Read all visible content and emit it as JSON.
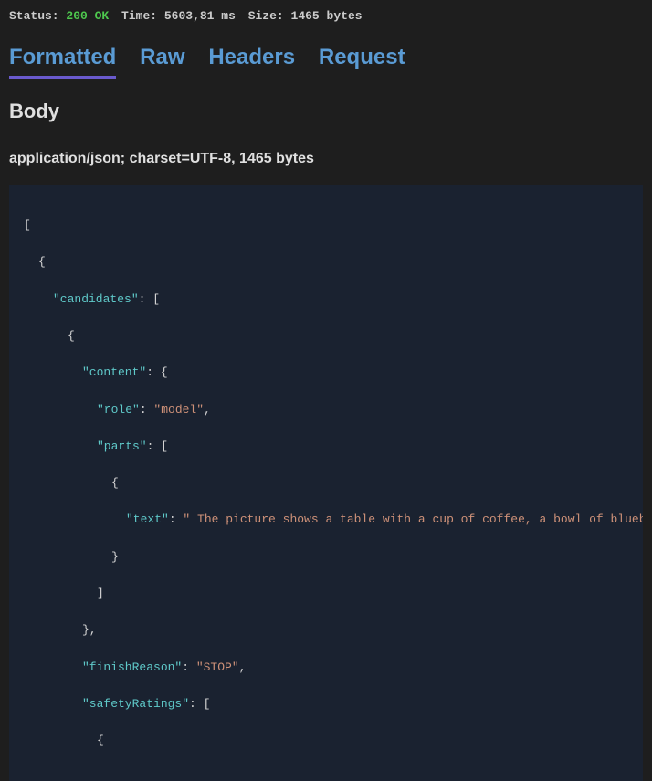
{
  "status_bar": {
    "status_label": "Status:",
    "status_value": "200 OK",
    "time_label": "Time:",
    "time_value": "5603,81 ms",
    "size_label": "Size:",
    "size_value": "1465 bytes"
  },
  "tabs": {
    "formatted": "Formatted",
    "raw": "Raw",
    "headers": "Headers",
    "request": "Request"
  },
  "body_heading": "Body",
  "content_type_line": "application/json; charset=UTF-8, 1465 bytes",
  "json": {
    "k_candidates": "\"candidates\"",
    "k_content": "\"content\"",
    "k_role": "\"role\"",
    "v_role": "\"model\"",
    "k_parts": "\"parts\"",
    "k_text": "\"text\"",
    "v_text": "\" The picture shows a table with a cup of coffee, a bowl of blueberr",
    "k_finishReason": "\"finishReason\"",
    "v_finishReason": "\"STOP\"",
    "k_safetyRatings": "\"safetyRatings\""
  }
}
